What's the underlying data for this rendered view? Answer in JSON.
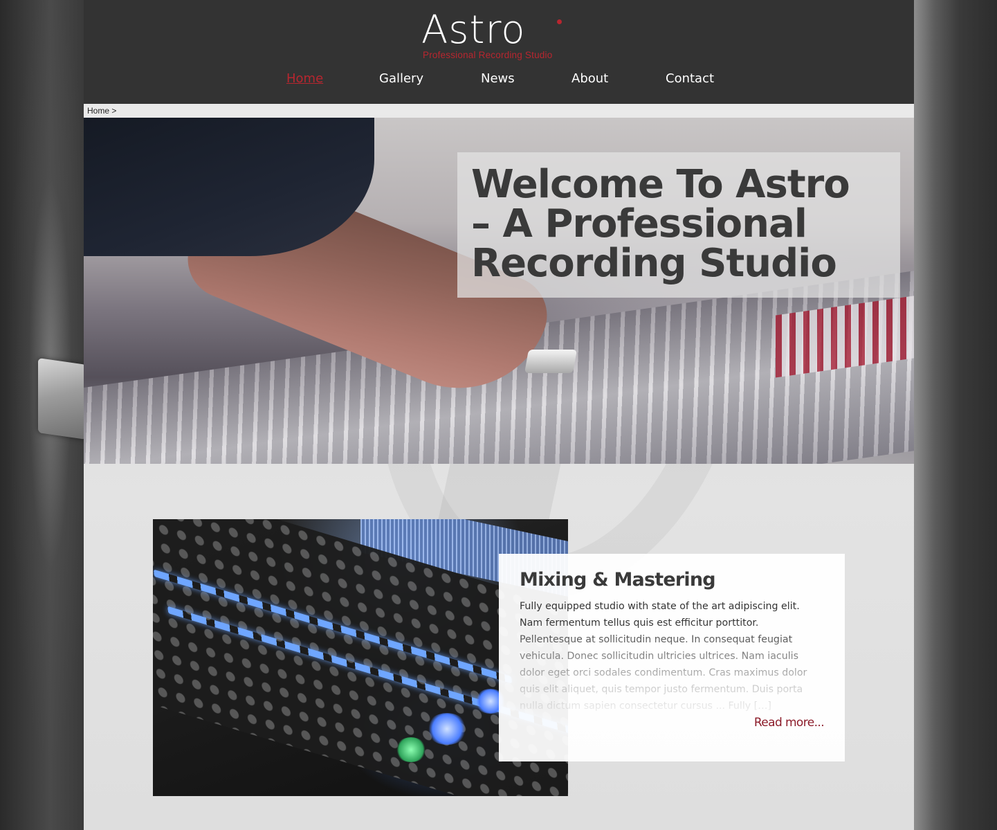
{
  "brand": {
    "logo_text": "Astro",
    "tagline": "Professional Recording Studio",
    "accent_color": "#b8262f"
  },
  "nav": {
    "items": [
      {
        "label": "Home",
        "active": true
      },
      {
        "label": "Gallery",
        "active": false
      },
      {
        "label": "News",
        "active": false
      },
      {
        "label": "About",
        "active": false
      },
      {
        "label": "Contact",
        "active": false
      }
    ]
  },
  "breadcrumb": "Home >",
  "hero": {
    "title_line1": "Welcome To Astro",
    "title_line2": "– A Professional",
    "title_line3": "Recording Studio"
  },
  "feature": {
    "heading": "Mixing & Mastering",
    "body": "Fully equipped studio with state of the art adipiscing elit. Nam fermentum tellus quis est efficitur porttitor. Pellentesque at sollicitudin neque. In consequat feugiat vehicula. Donec sollicitudin ultricies ultrices. Nam iaculis dolor eget orci sodales condimentum. Cras maximus dolor quis elit aliquet, quis tempor justo fermentum. Duis porta nulla dictum sapien consectetur cursus ... Fully […]",
    "read_more": "Read more..."
  }
}
